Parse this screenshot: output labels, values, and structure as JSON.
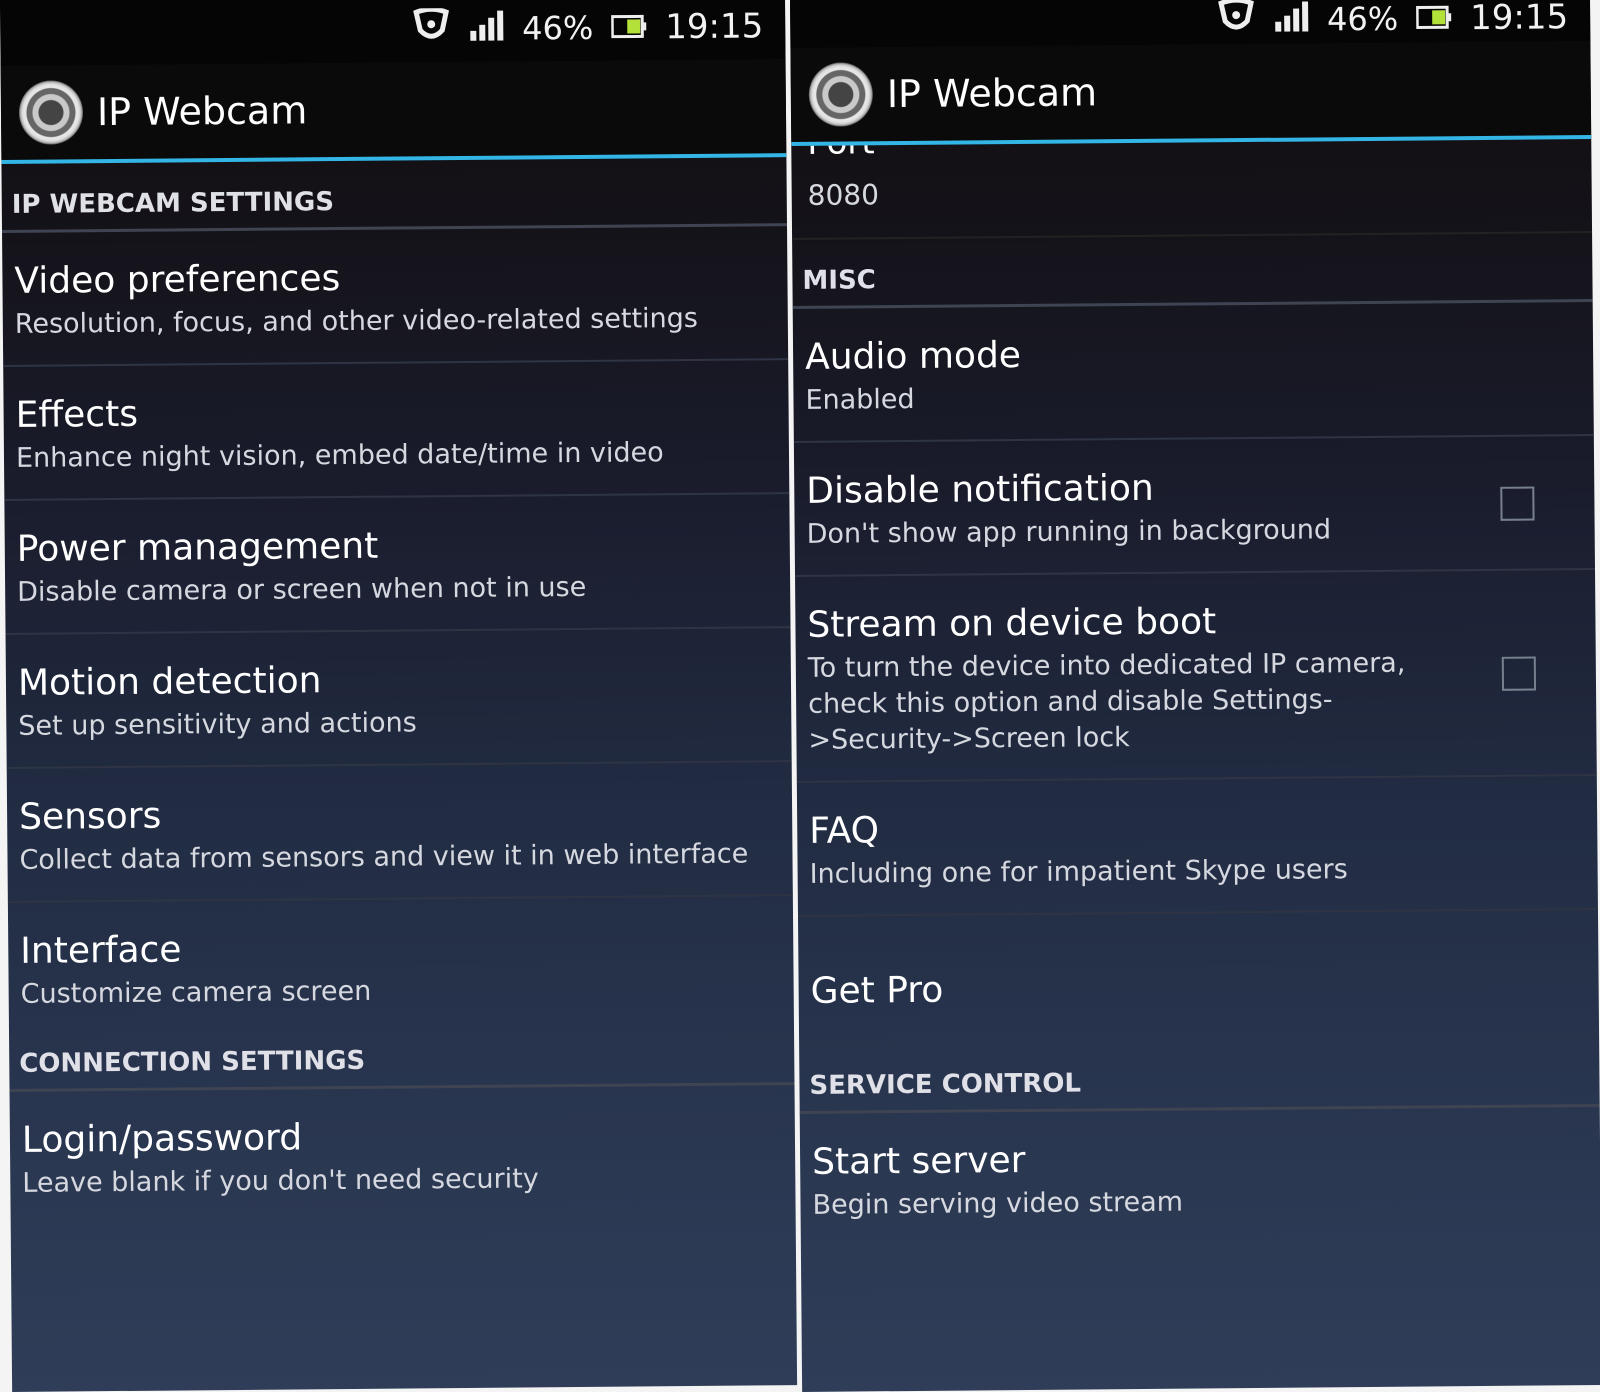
{
  "status_bar": {
    "battery_percent": "46%",
    "time": "19:15"
  },
  "app": {
    "title": "IP Webcam"
  },
  "left": {
    "section_title": "IP WEBCAM SETTINGS",
    "items": [
      {
        "title": "Video preferences",
        "summary": "Resolution, focus, and other video-related settings"
      },
      {
        "title": "Effects",
        "summary": "Enhance night vision, embed date/time in video"
      },
      {
        "title": "Power management",
        "summary": "Disable camera or screen when not in use"
      },
      {
        "title": "Motion detection",
        "summary": "Set up sensitivity and actions"
      },
      {
        "title": "Sensors",
        "summary": "Collect data from sensors and view it in web interface"
      },
      {
        "title": "Interface",
        "summary": "Customize camera screen"
      }
    ],
    "section2_title": "CONNECTION SETTINGS",
    "items2": [
      {
        "title": "Login/password",
        "summary": "Leave blank if you don't need security"
      }
    ]
  },
  "right": {
    "partial_item": {
      "title": "Port",
      "value": "8080"
    },
    "section_misc": "MISC",
    "misc_items": [
      {
        "title": "Audio mode",
        "summary": "Enabled"
      },
      {
        "title": "Disable notification",
        "summary": "Don't show app running in background",
        "checked": false
      },
      {
        "title": "Stream on device boot",
        "summary": "To turn the device into dedicated IP camera, check this option and disable Settings->Security->Screen lock",
        "checked": false
      },
      {
        "title": "FAQ",
        "summary": "Including one for impatient Skype users"
      },
      {
        "title": "Get Pro"
      }
    ],
    "section_service": "SERVICE CONTROL",
    "service_items": [
      {
        "title": "Start server",
        "summary": "Begin serving video stream"
      }
    ]
  },
  "icons": {
    "shield": "shield-icon",
    "signal": "signal-icon",
    "battery": "battery-icon",
    "app_logo": "camera-lens-icon",
    "checkbox": "checkbox-icon"
  },
  "colors": {
    "accent_line": "#33b5e5",
    "background_top": "#100e10",
    "background_bottom": "#2f3d58"
  }
}
